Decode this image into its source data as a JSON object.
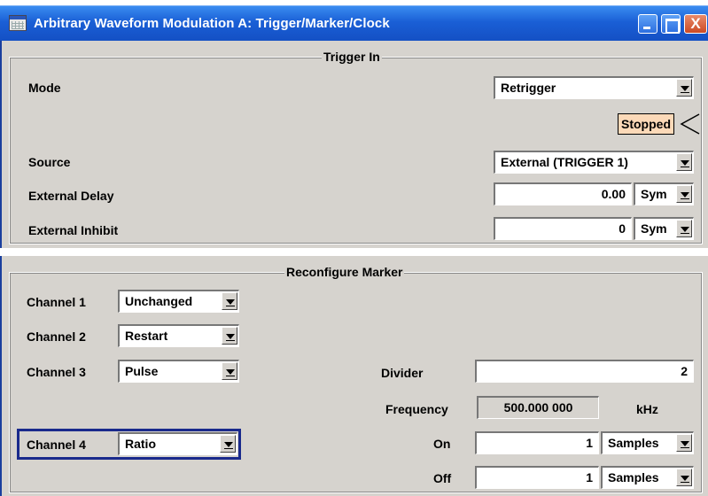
{
  "window": {
    "title": "Arbitrary Waveform Modulation  A: Trigger/Marker/Clock",
    "controls": {
      "minimize": "minimize-icon",
      "maximize": "maximize-icon",
      "close": "X"
    }
  },
  "trigger_in": {
    "group_label": "Trigger In",
    "mode": {
      "label": "Mode",
      "value": "Retrigger"
    },
    "status": "Stopped",
    "source": {
      "label": "Source",
      "value": "External (TRIGGER 1)"
    },
    "external_delay": {
      "label": "External Delay",
      "value": "0.00",
      "unit": "Sym"
    },
    "external_inhibit": {
      "label": "External Inhibit",
      "value": "0",
      "unit": "Sym"
    }
  },
  "reconfigure_marker": {
    "group_label": "Reconfigure Marker",
    "channels": [
      {
        "label": "Channel 1",
        "value": "Unchanged"
      },
      {
        "label": "Channel 2",
        "value": "Restart"
      },
      {
        "label": "Channel 3",
        "value": "Pulse"
      },
      {
        "label": "Channel 4",
        "value": "Ratio"
      }
    ],
    "divider": {
      "label": "Divider",
      "value": "2"
    },
    "frequency": {
      "label": "Frequency",
      "value": "500.000 000",
      "unit": "kHz"
    },
    "on": {
      "label": "On",
      "value": "1",
      "unit": "Samples"
    },
    "off": {
      "label": "Off",
      "value": "1",
      "unit": "Samples"
    }
  },
  "colors": {
    "titlebar": "#1a5fd6",
    "panel": "#d6d3ce",
    "status_bg": "#fcd9b8",
    "focus_border": "#1a2a8c"
  }
}
